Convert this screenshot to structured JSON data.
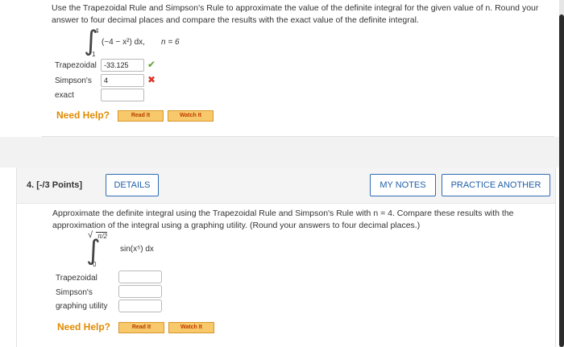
{
  "q1": {
    "instructions": "Use the Trapezoidal Rule and Simpson's Rule to approximate the value of the definite integral for the given value of n. Round your answer to four decimal places and compare the results with the exact value of the definite integral.",
    "integral": {
      "upper": "4",
      "lower": "1",
      "integrand": "(−4 − x²) dx,",
      "n_label": "n = 6"
    },
    "rows": [
      {
        "label": "Trapezoidal",
        "value": "-33.125",
        "status": "correct"
      },
      {
        "label": "Simpson's",
        "value": "4",
        "status": "incorrect"
      },
      {
        "label": "exact",
        "value": "",
        "status": ""
      }
    ],
    "need_help": "Need Help?",
    "read_it": "Read It",
    "watch_it": "Watch It"
  },
  "q2": {
    "number": "4.  [-/3 Points]",
    "details_btn": "DETAILS",
    "notes_btn": "MY NOTES",
    "practice_btn": "PRACTICE ANOTHER",
    "instructions": "Approximate the definite integral using the Trapezoidal Rule and Simpson's Rule with n = 4. Compare these results with the approximation of the integral using a graphing utility. (Round your answers to four decimal places.)",
    "integral": {
      "upper": "π/2",
      "lower": "0",
      "integrand": "sin(x⁵) dx"
    },
    "rows": [
      {
        "label": "Trapezoidal",
        "value": ""
      },
      {
        "label": "Simpson's",
        "value": ""
      },
      {
        "label": "graphing utility",
        "value": ""
      }
    ],
    "need_help": "Need Help?",
    "read_it": "Read It",
    "watch_it": "Watch It"
  },
  "colors": {
    "accent": "#1f5fa8",
    "help": "#e08a00",
    "correct": "#5aa02c",
    "incorrect": "#d9362c"
  }
}
